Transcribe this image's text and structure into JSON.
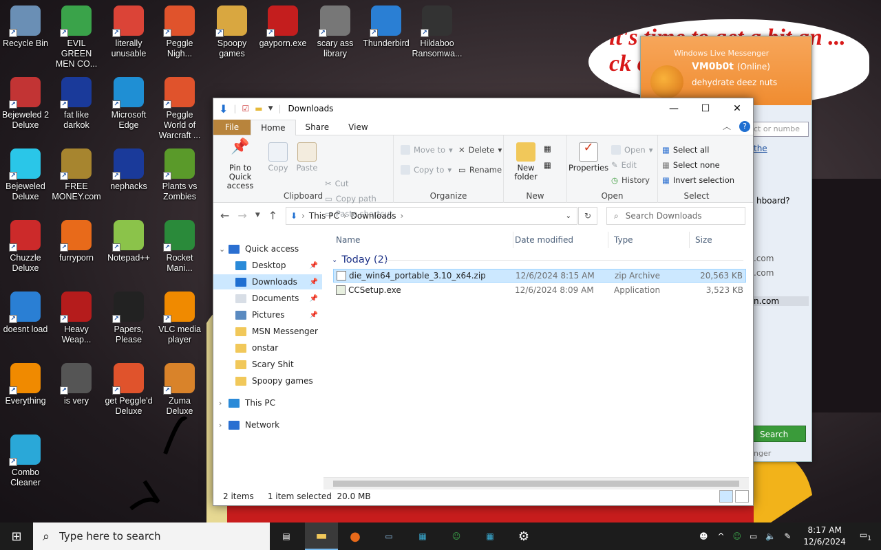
{
  "desktop": {
    "icons": [
      {
        "label": "Recycle Bin",
        "icon": "recycle-bin-icon",
        "color": "#6a8fb5"
      },
      {
        "label": "EVIL GREEN MEN CO...",
        "icon": "msn-people-icon",
        "color": "#3aa34a"
      },
      {
        "label": "literally unusable",
        "icon": "chrome-icon",
        "color": "#db4437"
      },
      {
        "label": "Peggle Nigh...",
        "icon": "peggle-icon",
        "color": "#e0532c"
      },
      {
        "label": "Spoopy games",
        "icon": "folder-icon",
        "color": "#d9a740"
      },
      {
        "label": "gayporn.exe",
        "icon": "flash-icon",
        "color": "#c41e1e"
      },
      {
        "label": "scary ass library",
        "icon": "library-icon",
        "color": "#777"
      },
      {
        "label": "Thunderbird",
        "icon": "thunderbird-icon",
        "color": "#2a7fd4"
      },
      {
        "label": "Hildaboo Ransomwa...",
        "icon": "shield-icon",
        "color": "#333"
      },
      {
        "label": "Bejeweled 2 Deluxe",
        "icon": "bejeweled-icon",
        "color": "#c23434"
      },
      {
        "label": "fat like darkok",
        "icon": "mpi-icon",
        "color": "#1a3a9a"
      },
      {
        "label": "Microsoft Edge",
        "icon": "edge-icon",
        "color": "#1f8fd4"
      },
      {
        "label": "Peggle World of Warcraft ...",
        "icon": "peggle-icon",
        "color": "#e0532c"
      },
      {
        "label": "Bejeweled Deluxe",
        "icon": "gem-icon",
        "color": "#2ac6e8"
      },
      {
        "label": "FREE MONEY.com",
        "icon": "money-bag-icon",
        "color": "#a7852f"
      },
      {
        "label": "nephacks",
        "icon": "mpi-icon",
        "color": "#1a3a9a"
      },
      {
        "label": "Plants vs Zombies",
        "icon": "flower-icon",
        "color": "#5a9a2a"
      },
      {
        "label": "Chuzzle Deluxe",
        "icon": "chuzzle-icon",
        "color": "#cc2a2a"
      },
      {
        "label": "furryporn",
        "icon": "firefox-icon",
        "color": "#e86a1a"
      },
      {
        "label": "Notepad++",
        "icon": "notepad-icon",
        "color": "#8bc34a"
      },
      {
        "label": "Rocket Mani...",
        "icon": "rocket-icon",
        "color": "#2a8a3a"
      },
      {
        "label": "doesnt load",
        "icon": "thunderbird-icon",
        "color": "#2a7fd4"
      },
      {
        "label": "Heavy Weap...",
        "icon": "radiation-icon",
        "color": "#b51c1c"
      },
      {
        "label": "Papers, Please",
        "icon": "papers-please-icon",
        "color": "#222"
      },
      {
        "label": "VLC media player",
        "icon": "vlc-icon",
        "color": "#f08a00"
      },
      {
        "label": "Everything",
        "icon": "search-icon",
        "color": "#f08a00"
      },
      {
        "label": "is very",
        "icon": "mpi-icon",
        "color": "#555"
      },
      {
        "label": "get Peggle'd Deluxe",
        "icon": "peggle-icon",
        "color": "#e0532c"
      },
      {
        "label": "Zuma Deluxe",
        "icon": "zuma-icon",
        "color": "#d9832a"
      },
      {
        "label": "Combo Cleaner",
        "icon": "combo-cleaner-icon",
        "color": "#2aa8d8"
      }
    ]
  },
  "bubble": {
    "text": "it's time to get a bit an ... ck or ..."
  },
  "messenger": {
    "title": "Windows Live Messenger",
    "contact": "VM0b0t",
    "status": "(Online)",
    "message": "dehydrate deez nuts",
    "search_placeholder": "ct or numbe",
    "link": "the",
    "text1": "hboard?",
    "text2": ".com",
    "text3": ".com",
    "text4": "n.com",
    "search_label": "Search",
    "footer": "nger"
  },
  "explorer": {
    "title": "Downloads",
    "tabs": [
      "File",
      "Home",
      "Share",
      "View"
    ],
    "ribbon": {
      "clipboard": {
        "name": "Clipboard",
        "pin": "Pin to Quick access",
        "copy": "Copy",
        "paste": "Paste",
        "cut": "Cut",
        "copy_path": "Copy path",
        "paste_shortcut": "Paste shortcut"
      },
      "organize": {
        "name": "Organize",
        "move_to": "Move to",
        "copy_to": "Copy to",
        "delete": "Delete",
        "rename": "Rename"
      },
      "new": {
        "name": "New",
        "new_folder": "New folder"
      },
      "open": {
        "name": "Open",
        "properties": "Properties",
        "open": "Open",
        "edit": "Edit",
        "history": "History"
      },
      "select": {
        "name": "Select",
        "select_all": "Select all",
        "select_none": "Select none",
        "invert": "Invert selection"
      }
    },
    "address": {
      "crumbs": [
        "This PC",
        "Downloads"
      ],
      "search_placeholder": "Search Downloads"
    },
    "nav": [
      {
        "label": "Quick access",
        "icon": "star-icon",
        "pinned": false
      },
      {
        "label": "Desktop",
        "icon": "desktop-icon",
        "pinned": true
      },
      {
        "label": "Downloads",
        "icon": "download-icon",
        "pinned": true
      },
      {
        "label": "Documents",
        "icon": "document-icon",
        "pinned": true
      },
      {
        "label": "Pictures",
        "icon": "pictures-icon",
        "pinned": true
      },
      {
        "label": "MSN Messenger",
        "icon": "folder-icon",
        "pinned": false
      },
      {
        "label": "onstar",
        "icon": "folder-icon",
        "pinned": false
      },
      {
        "label": "Scary Shit",
        "icon": "folder-icon",
        "pinned": false
      },
      {
        "label": "Spoopy games",
        "icon": "folder-icon",
        "pinned": false
      },
      {
        "label": "This PC",
        "icon": "pc-icon",
        "pinned": false
      },
      {
        "label": "Network",
        "icon": "network-icon",
        "pinned": false
      }
    ],
    "columns": [
      "Name",
      "Date modified",
      "Type",
      "Size"
    ],
    "group": "Today (2)",
    "files": [
      {
        "name": "die_win64_portable_3.10_x64.zip",
        "date": "12/6/2024 8:15 AM",
        "type": "zip Archive",
        "size": "20,563 KB"
      },
      {
        "name": "CCSetup.exe",
        "date": "12/6/2024 8:09 AM",
        "type": "Application",
        "size": "3,523 KB"
      }
    ],
    "status": {
      "items": "2 items",
      "selected": "1 item selected",
      "size": "20.0 MB"
    }
  },
  "taskbar": {
    "search_placeholder": "Type here to search",
    "time": "8:17 AM",
    "date": "12/6/2024",
    "notif_count": "1"
  }
}
